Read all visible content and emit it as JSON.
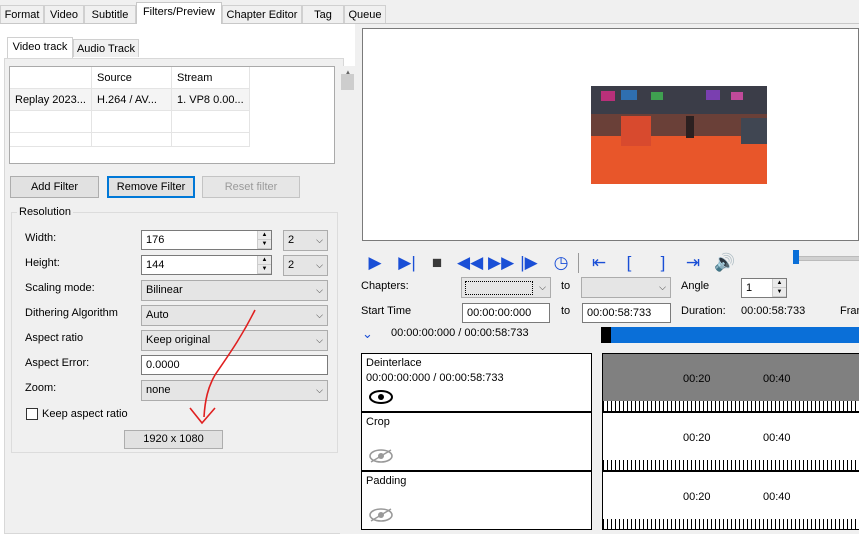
{
  "tabs": [
    "Format",
    "Video",
    "Subtitle",
    "Filters/Preview",
    "Chapter Editor",
    "Tag",
    "Queue"
  ],
  "subtabs": [
    "Video track",
    "Audio Track"
  ],
  "grid": {
    "headers": [
      "",
      "Source",
      "Stream"
    ],
    "rows": [
      [
        "Replay 2023...",
        "H.264 / AV...",
        "1. VP8 0.00..."
      ]
    ]
  },
  "buttons": {
    "add": "Add Filter",
    "remove": "Remove Filter",
    "reset": "Reset filter"
  },
  "resolution": {
    "title": "Resolution",
    "width_label": "Width:",
    "width_value": "176",
    "width_div": "2",
    "height_label": "Height:",
    "height_value": "144",
    "height_div": "2",
    "scaling_label": "Scaling mode:",
    "scaling_value": "Bilinear",
    "dither_label": "Dithering Algorithm",
    "dither_value": "Auto",
    "aspect_label": "Aspect ratio",
    "aspect_value": "Keep original",
    "aspect_err_label": "Aspect Error:",
    "aspect_err_value": "0.0000",
    "zoom_label": "Zoom:",
    "zoom_value": "none",
    "keep_label": "Keep aspect ratio",
    "size_button": "1920 x 1080"
  },
  "playback": {
    "chapters_label": "Chapters:",
    "to1": "to",
    "angle_label": "Angle",
    "angle_value": "1",
    "start_label": "Start Time",
    "start_value": "00:00:00:000",
    "to2": "to",
    "end_value": "00:00:58:733",
    "duration_label": "Duration:",
    "duration_value": "00:00:58:733",
    "fra_label": "Fran",
    "position": "00:00:00:000 / 00:00:58:733",
    "progress_fraction": 0.0
  },
  "filters": [
    {
      "name": "Deinterlace",
      "time": "00:00:00:000 / 00:00:58:733",
      "active": true
    },
    {
      "name": "Crop",
      "time": "",
      "active": false
    },
    {
      "name": "Padding",
      "time": "",
      "active": false
    }
  ],
  "ruler_labels": [
    "00:20",
    "00:40"
  ],
  "colors": {
    "accent": "#1a4fd6",
    "focus": "#0078d7",
    "progress": "#0a6fd8",
    "annotation": "#e02020"
  }
}
